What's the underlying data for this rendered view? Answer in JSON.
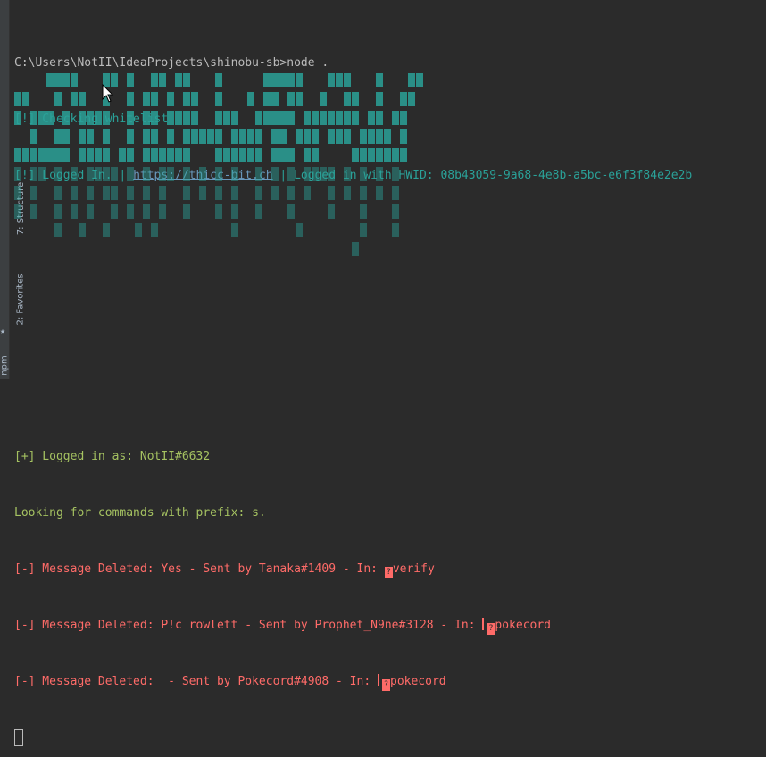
{
  "sidebar": {
    "tabs": [
      "7: Structure",
      "2: Favorites",
      "npm"
    ]
  },
  "terminal": {
    "prompt": "C:\\Users\\NotII\\IdeaProjects\\shinobu-sb>node .",
    "checking": "[!] Checking whitelist",
    "logged_prefix": "[!] Logged In. | ",
    "logged_link": "https://thicc-bit.ch",
    "logged_suffix": " | Logged in with HWID: 08b43059-9a68-4e8b-a5bc-e6f3f84e2e2b",
    "logged_as": "[+] Logged in as: NotII#6632",
    "prefix_line": "Looking for commands with prefix: s.",
    "deleted": [
      {
        "before": "[-] Message Deleted: Yes - Sent by Tanaka#1409 - In: ",
        "bar": false,
        "channel": "verify"
      },
      {
        "before": "[-] Message Deleted: P!c rowlett - Sent by Prophet_N9ne#3128 - In: ",
        "bar": true,
        "channel": "pokecord"
      },
      {
        "before": "[-] Message Deleted:  - Sent by Pokecord#4908 - In: ",
        "bar": true,
        "channel": "pokecord"
      }
    ]
  },
  "colors": {
    "background": "#2b2b2b",
    "teal": "#2aa198",
    "red": "#ff6b68",
    "green": "#a5c261",
    "link": "#6897bb"
  }
}
